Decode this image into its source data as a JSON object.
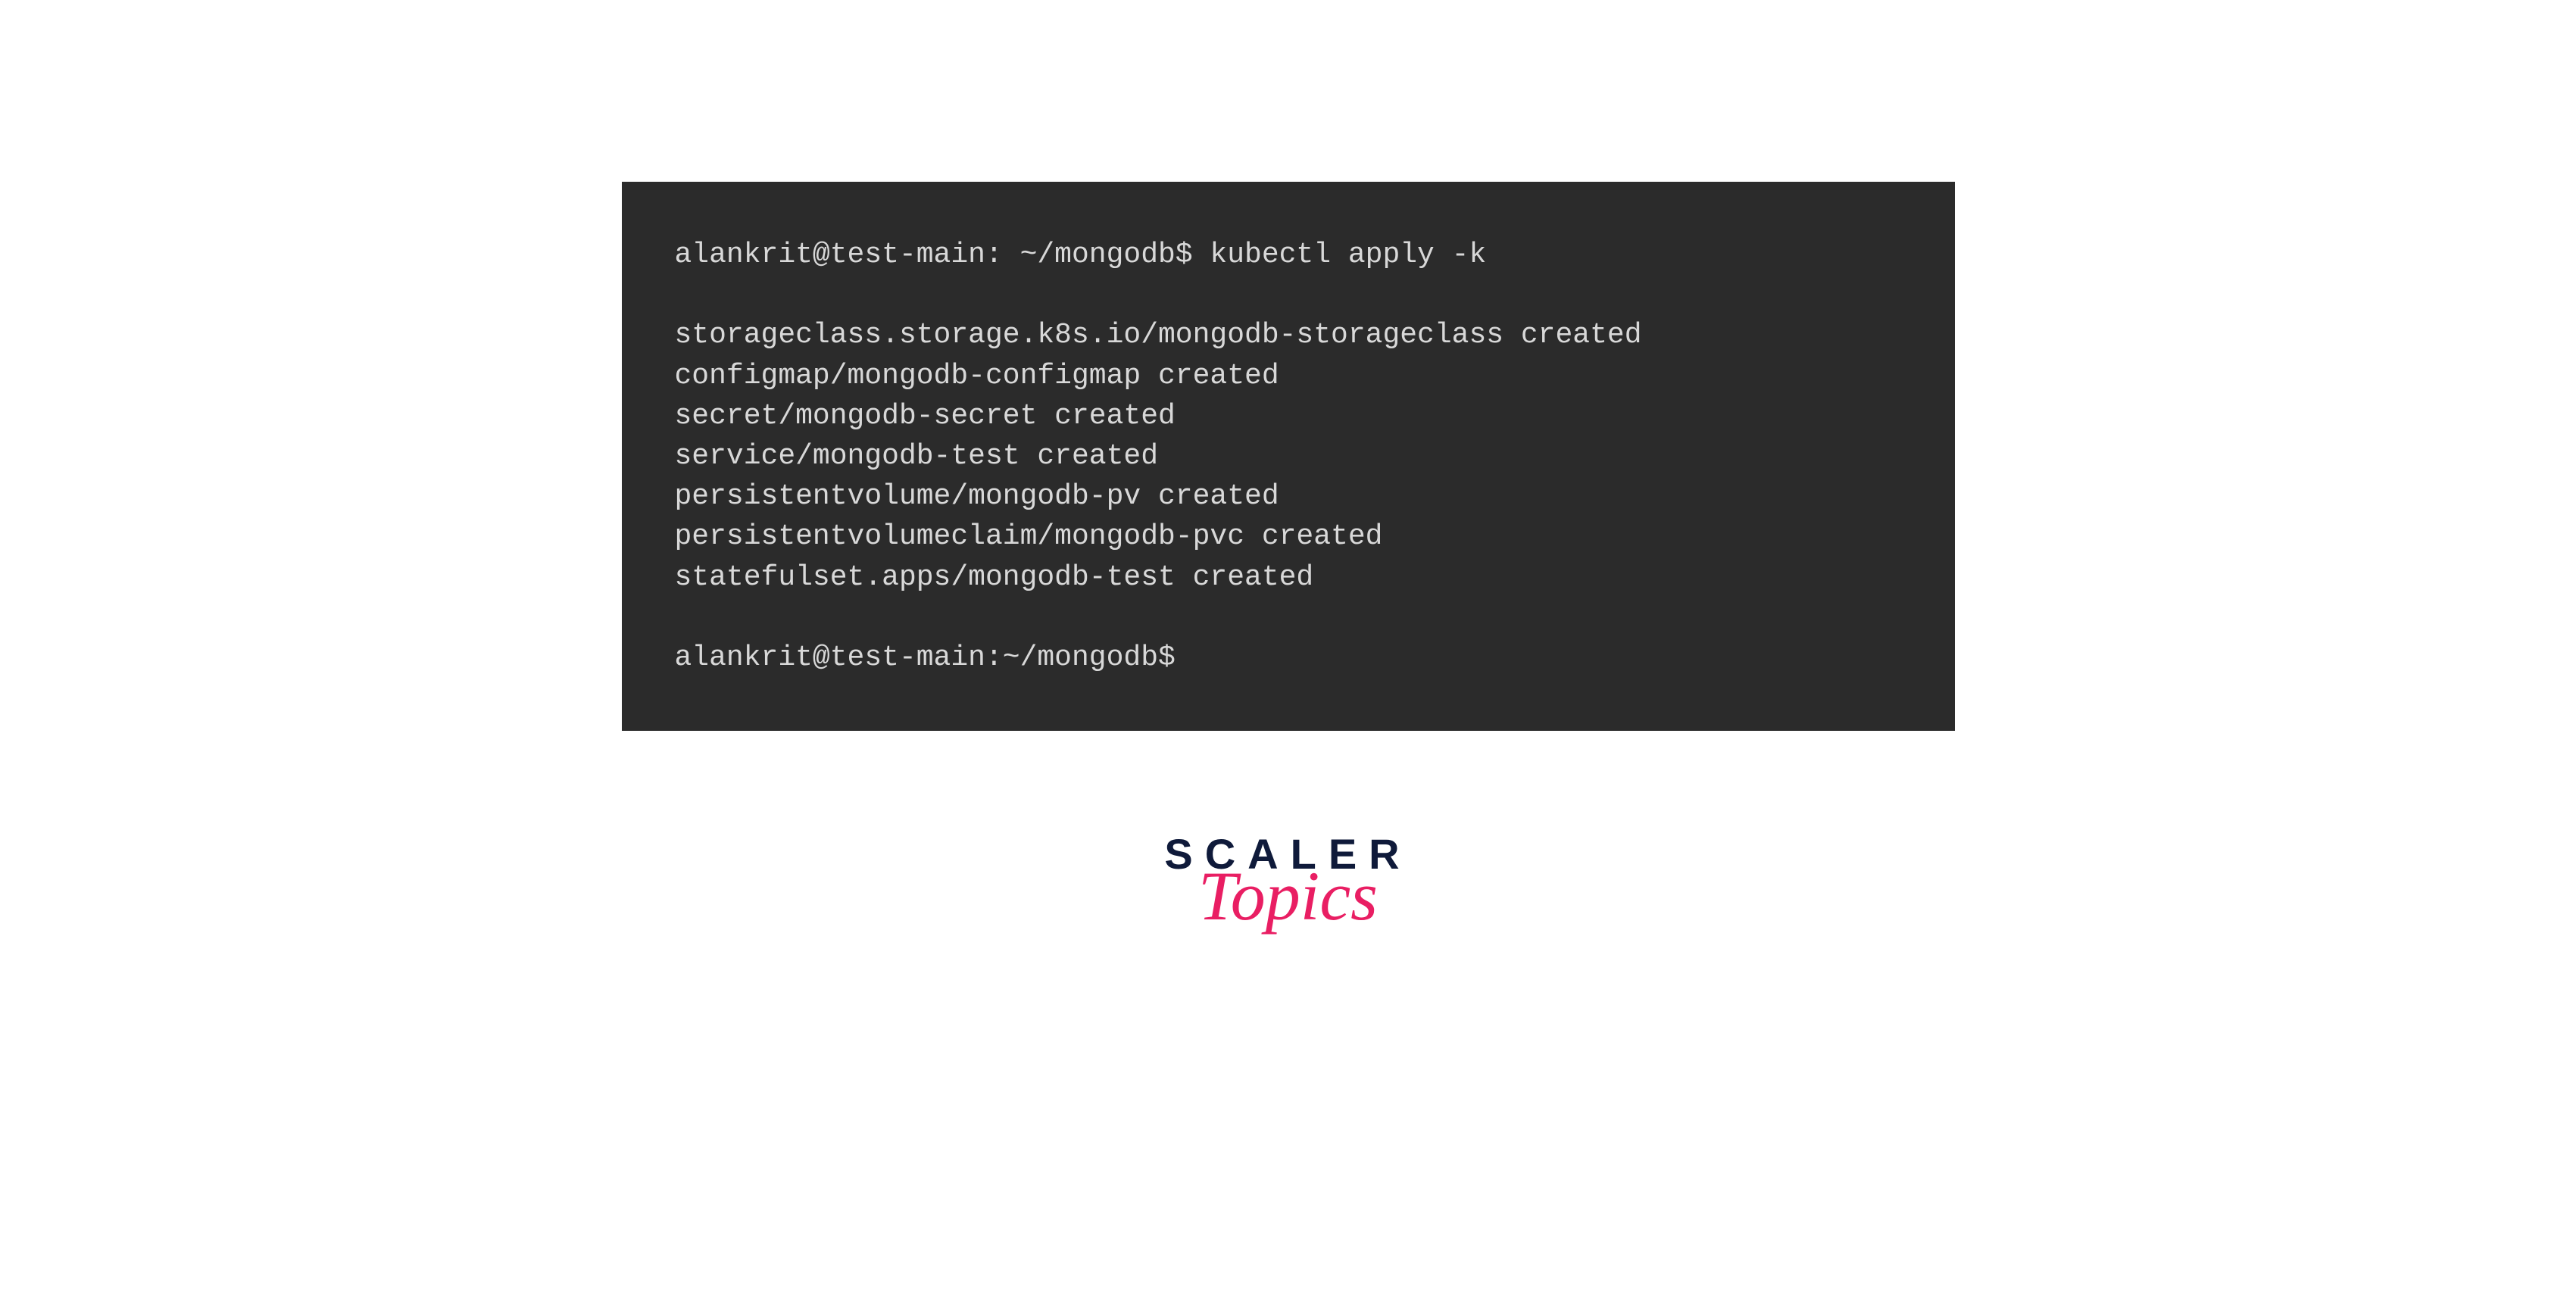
{
  "terminal": {
    "lines": [
      "alankrit@test-main: ~/mongodb$ kubectl apply -k",
      "",
      "storageclass.storage.k8s.io/mongodb-storageclass created",
      "configmap/mongodb-configmap created",
      "secret/mongodb-secret created",
      "service/mongodb-test created",
      "persistentvolume/mongodb-pv created",
      "persistentvolumeclaim/mongodb-pvc created",
      "statefulset.apps/mongodb-test created",
      "",
      "alankrit@test-main:~/mongodb$"
    ]
  },
  "logo": {
    "line1": "SCALER",
    "line2": "Topics"
  }
}
